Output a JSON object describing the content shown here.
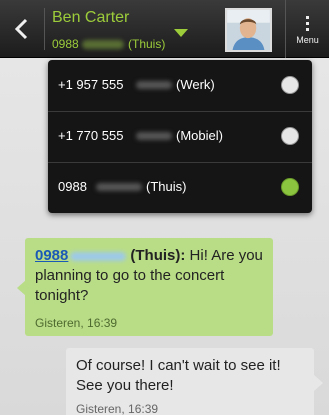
{
  "header": {
    "contact_name": "Ben Carter",
    "contact_number": "0988",
    "contact_label": "(Thuis)",
    "menu_label": "Menu"
  },
  "number_picker": {
    "options": [
      {
        "number": "+1 957 555",
        "label": "(Werk)",
        "selected": false
      },
      {
        "number": "+1 770 555",
        "label": "(Mobiel)",
        "selected": false
      },
      {
        "number": "0988",
        "label": "(Thuis)",
        "selected": true
      }
    ]
  },
  "messages": [
    {
      "direction": "incoming",
      "sender_number": "0988",
      "sender_label": "(Thuis):",
      "text": "Hi! Are you planning to go to the concert tonight?",
      "time": "Gisteren, 16:39"
    },
    {
      "direction": "outgoing",
      "text": "Of course! I can't wait to see it! See you there!",
      "time": "Gisteren, 16:39"
    }
  ],
  "colors": {
    "accent": "#9ccc3a",
    "incoming_bubble": "#b9dd87",
    "outgoing_bubble": "#e7e7e7",
    "radio_selected": "#8bc53f"
  },
  "icons": {
    "back": "chevron-left-icon",
    "dropdown": "triangle-down-icon",
    "menu": "overflow-menu-icon"
  }
}
